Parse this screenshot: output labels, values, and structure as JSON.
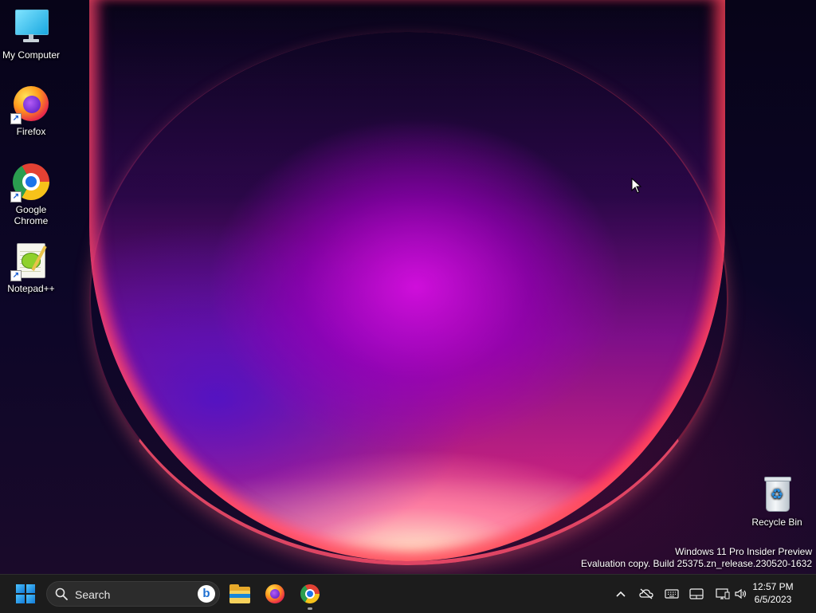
{
  "desktop": {
    "icons": [
      {
        "label": "My Computer",
        "icon": "monitor-icon"
      },
      {
        "label": "Firefox",
        "icon": "firefox-icon"
      },
      {
        "label": "Google Chrome",
        "icon": "chrome-icon"
      },
      {
        "label": "Notepad++",
        "icon": "notepad-plus-plus-icon"
      },
      {
        "label": "Recycle Bin",
        "icon": "recycle-bin-icon"
      }
    ],
    "watermark": {
      "line1": "Windows 11 Pro Insider Preview",
      "line2": "Evaluation copy. Build 25375.zn_release.230520-1632"
    }
  },
  "taskbar": {
    "search": {
      "placeholder": "Search"
    },
    "pinned": [
      {
        "name": "File Explorer",
        "icon": "file-explorer-icon"
      },
      {
        "name": "Firefox",
        "icon": "firefox-icon"
      },
      {
        "name": "Google Chrome",
        "icon": "chrome-icon",
        "running": true
      }
    ],
    "tray": {
      "icons": [
        "chevron-up-icon",
        "cloud-offline-icon",
        "keyboard-icon",
        "touchpad-icon",
        "network-icon",
        "volume-icon"
      ]
    },
    "clock": {
      "time": "12:57 PM",
      "date": "6/5/2023"
    }
  },
  "colors": {
    "taskbar_bg": "#1c1c1c",
    "accent": "#1a86d8"
  }
}
